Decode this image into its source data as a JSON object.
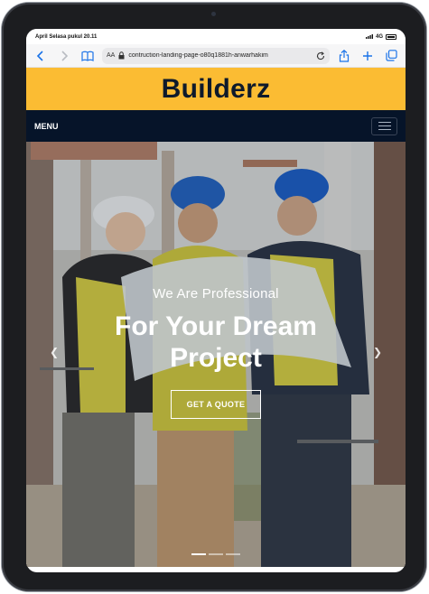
{
  "status": {
    "carrier_time": "April Selasa pukul 20.11",
    "network": "4G"
  },
  "browser": {
    "text_size_label": "AA",
    "url": "contruction-landing-page-o80q1881h-anwarhakim"
  },
  "site": {
    "brand": "Builderz",
    "nav_label": "MENU",
    "hero": {
      "subtitle": "We Are Professional",
      "title": "For Your Dream Project",
      "cta_label": "GET A QUOTE"
    }
  },
  "icons": {
    "back": "chevron-left-icon",
    "forward": "chevron-right-icon",
    "bookmarks": "book-icon",
    "lock": "lock-icon",
    "reload": "reload-icon",
    "share": "share-icon",
    "new_tab": "plus-icon",
    "tabs": "tabs-icon",
    "hamburger": "hamburger-icon",
    "carousel_prev": "arrow-left-icon",
    "carousel_next": "arrow-right-icon"
  },
  "colors": {
    "brand_bar": "#fbbc33",
    "navbar": "#061429",
    "device_frame": "#1c1d20",
    "link_blue": "#1a73e8"
  },
  "carousel": {
    "slide_count": 3,
    "active_slide": 1
  }
}
